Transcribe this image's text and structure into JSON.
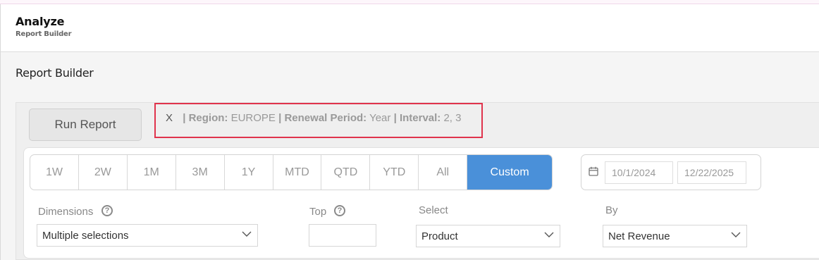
{
  "header": {
    "title": "Analyze",
    "subtitle": "Report Builder"
  },
  "page": {
    "title": "Report Builder"
  },
  "toolbar": {
    "run_label": "Run Report"
  },
  "filters": {
    "close_label": "X",
    "sep": "|",
    "items": [
      {
        "key": "Region:",
        "value": "EUROPE"
      },
      {
        "key": "Renewal Period:",
        "value": "Year"
      },
      {
        "key": "Interval:",
        "value": "2, 3"
      }
    ]
  },
  "ranges": {
    "items": [
      "1W",
      "2W",
      "1M",
      "3M",
      "1Y",
      "MTD",
      "QTD",
      "YTD",
      "All",
      "Custom"
    ],
    "selected": "Custom"
  },
  "dates": {
    "start": "10/1/2024",
    "end": "12/22/2025"
  },
  "dimensions": {
    "label": "Dimensions",
    "help": "?",
    "value": "Multiple selections"
  },
  "top": {
    "label": "Top",
    "help": "?",
    "value": ""
  },
  "select": {
    "label": "Select",
    "value": "Product"
  },
  "by": {
    "label": "By",
    "value": "Net Revenue"
  },
  "colors": {
    "accent": "#4a90d9",
    "highlight_border": "#e0334c"
  },
  "icons": {
    "calendar": "calendar-icon",
    "chevron": "chevron-down-icon",
    "help": "help-circle-icon"
  }
}
